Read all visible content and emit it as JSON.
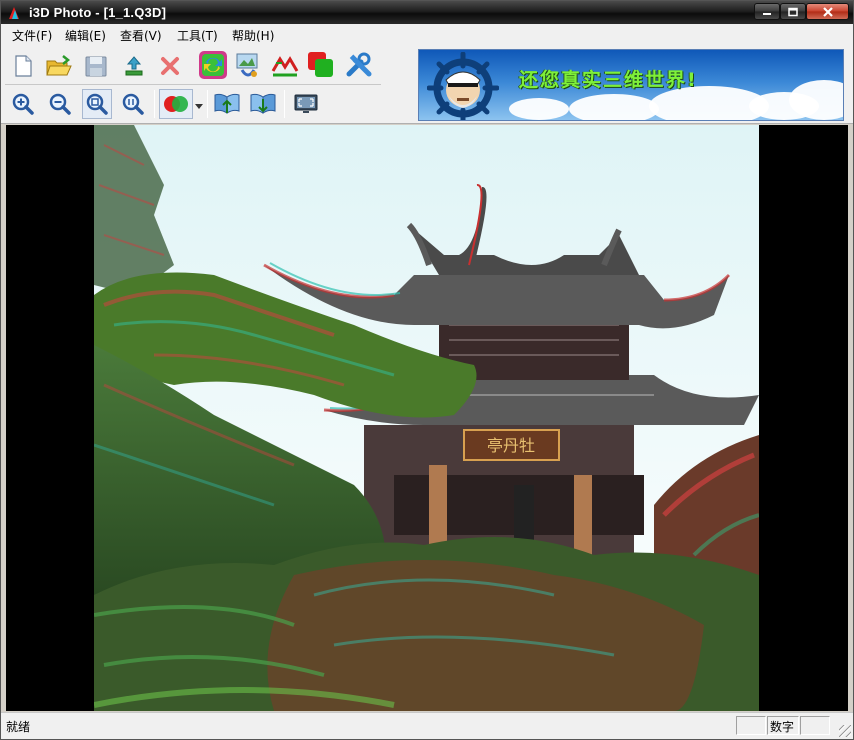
{
  "window": {
    "title": "i3D Photo - [1_1.Q3D]"
  },
  "menu": [
    {
      "label": "文件(F)"
    },
    {
      "label": "编辑(E)"
    },
    {
      "label": "查看(V)"
    },
    {
      "label": "工具(T)"
    },
    {
      "label": "帮助(H)"
    }
  ],
  "toolbar": {
    "row1": [
      "new-document-icon",
      "open-folder-icon",
      "save-icon",
      "export-icon",
      "delete-icon",
      "convert-3d-icon",
      "stereo-align-icon",
      "swap-views-icon",
      "layer-blend-icon",
      "tools-icon"
    ],
    "row2": [
      "zoom-in-icon",
      "zoom-out-icon",
      "fit-window-icon",
      "actual-size-icon",
      "anaglyph-mode-icon",
      "view-left-icon",
      "view-right-icon",
      "fullscreen-icon"
    ]
  },
  "banner": {
    "text": "还您真实三维世界!"
  },
  "status": {
    "text": "就绪",
    "panel_num": "数字",
    "panel_caps": "",
    "panel_scroll": ""
  },
  "colors": {
    "titlebar": "#1e1e1e",
    "chrome": "#f0f0f0",
    "viewer_bg": "#000000",
    "banner_text": "#7ef03a"
  }
}
